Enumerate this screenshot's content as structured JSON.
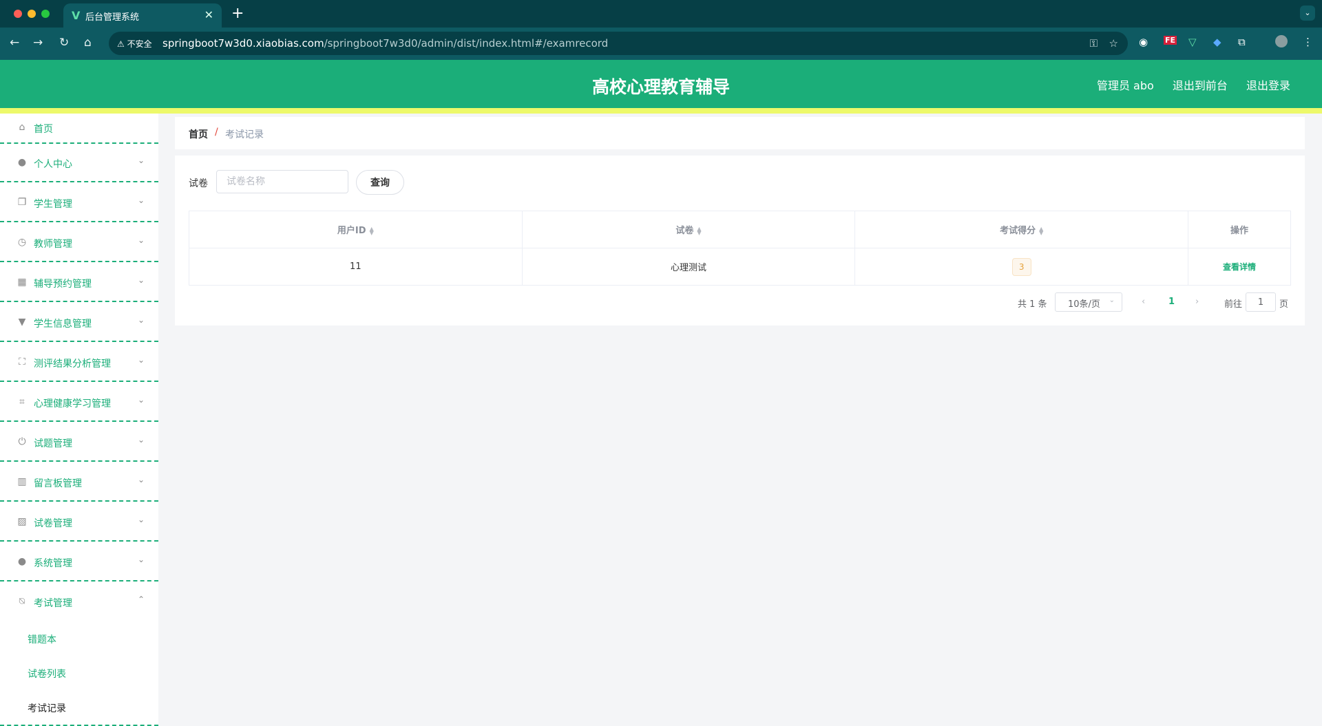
{
  "browser": {
    "tab_title": "后台管理系统",
    "tab_favicon": "V",
    "security_label": "不安全",
    "url_host": "springboot7w3d0.xiaobias.com",
    "url_path": "/springboot7w3d0/admin/dist/index.html#/examrecord",
    "ext_fe": "FE"
  },
  "header": {
    "title": "高校心理教育辅导",
    "user_label": "管理员 abo",
    "front_label": "退出到前台",
    "logout_label": "退出登录",
    "color": "#1bae79"
  },
  "sidebar": {
    "items": [
      {
        "label": "首页",
        "icon": "home-icon"
      },
      {
        "label": "个人中心",
        "icon": "person-icon"
      },
      {
        "label": "学生管理",
        "icon": "copy-icon"
      },
      {
        "label": "教师管理",
        "icon": "clock-icon"
      },
      {
        "label": "辅导预约管理",
        "icon": "grid-icon"
      },
      {
        "label": "学生信息管理",
        "icon": "brush-icon"
      },
      {
        "label": "测评结果分析管理",
        "icon": "fullscreen-icon"
      },
      {
        "label": "心理健康学习管理",
        "icon": "crop-icon"
      },
      {
        "label": "试题管理",
        "icon": "power-icon"
      },
      {
        "label": "留言板管理",
        "icon": "bar-icon"
      },
      {
        "label": "试卷管理",
        "icon": "chart-icon"
      },
      {
        "label": "系统管理",
        "icon": "user-icon"
      },
      {
        "label": "考试管理",
        "icon": "bell-off-icon"
      }
    ],
    "subitems": [
      {
        "label": "错题本"
      },
      {
        "label": "试卷列表"
      },
      {
        "label": "考试记录"
      }
    ]
  },
  "breadcrumb": {
    "home": "首页",
    "separator": "/",
    "current": "考试记录"
  },
  "search": {
    "label": "试卷",
    "placeholder": "试卷名称",
    "button": "查询"
  },
  "table": {
    "columns": [
      "用户ID",
      "试卷",
      "考试得分",
      "操作"
    ],
    "rows": [
      {
        "user_id": "11",
        "paper": "心理测试",
        "score": "3",
        "action": "查看详情"
      }
    ]
  },
  "pagination": {
    "total": "共 1 条",
    "page_size": "10条/页",
    "current_page": "1",
    "goto_label": "前往",
    "goto_value": "1",
    "page_suffix": "页"
  }
}
